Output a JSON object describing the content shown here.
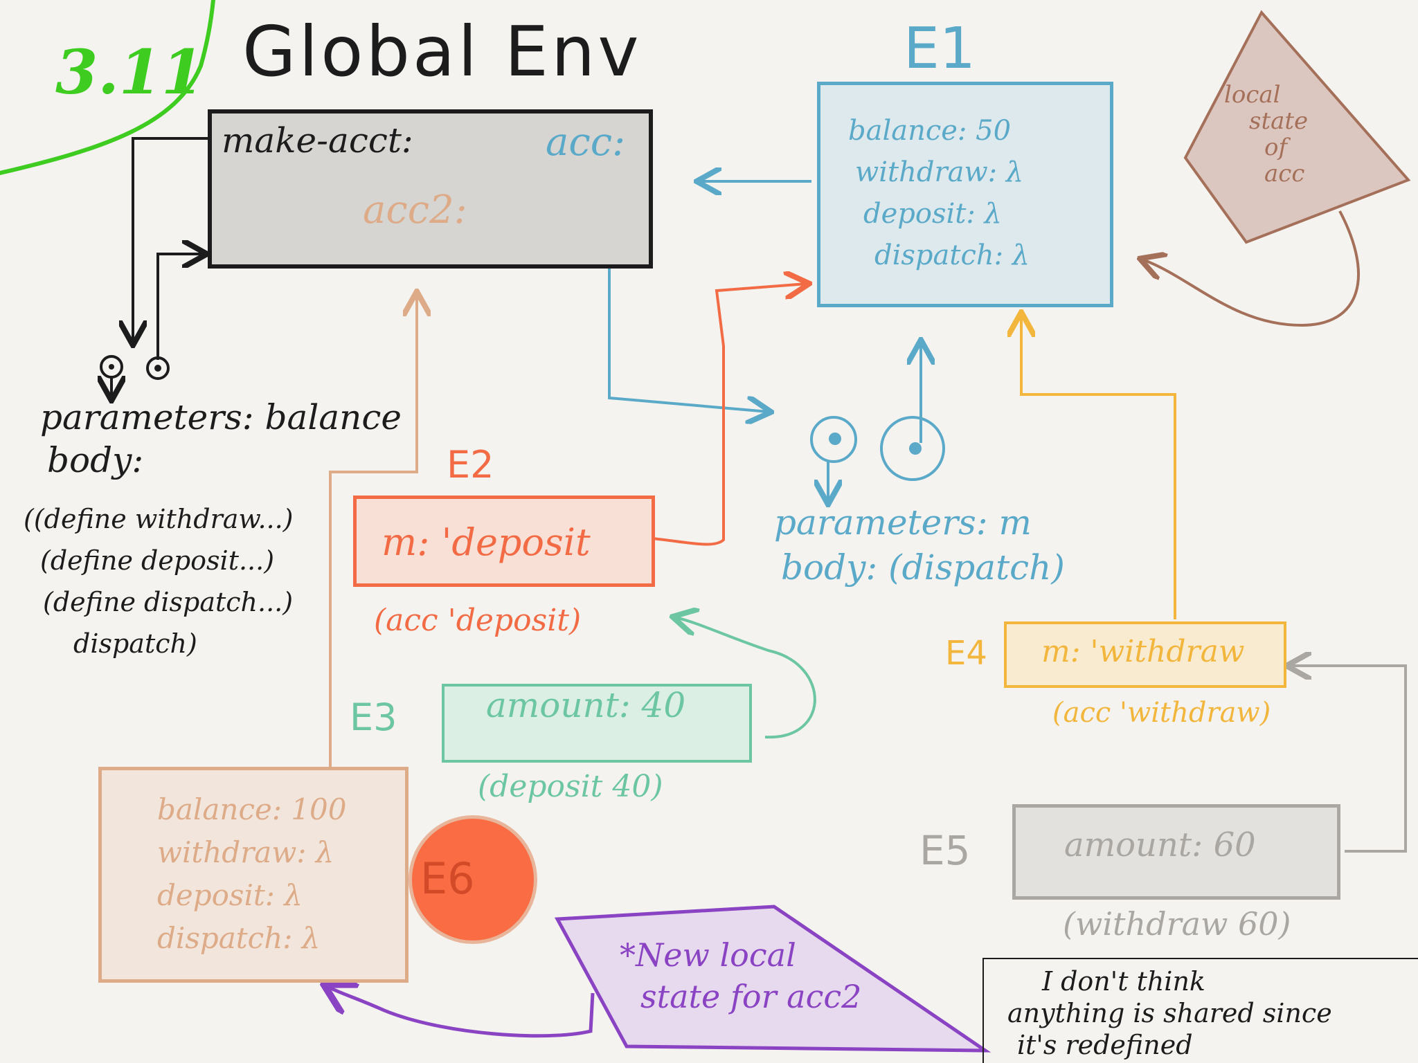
{
  "section": "3.11",
  "global_env": {
    "title": "Global Env",
    "make_acct": "make-acct:",
    "acc": "acc:",
    "acc2": "acc2:"
  },
  "procedure_make_acct": {
    "parameters": "parameters: balance",
    "body_label": "body:",
    "body_lines": [
      "((define withdraw...)",
      "(define deposit...)",
      "(define dispatch...)",
      "dispatch)"
    ]
  },
  "e1": {
    "label": "E1",
    "lines": [
      "balance: 50",
      "withdraw: λ",
      "deposit: λ",
      "dispatch: λ"
    ]
  },
  "local_state_note": [
    "local",
    "state",
    "of",
    "acc"
  ],
  "procedure_dispatch": {
    "parameters": "parameters: m",
    "body": "body: (dispatch)"
  },
  "e2": {
    "label": "E2",
    "binding": "m: 'deposit",
    "call": "(acc 'deposit)"
  },
  "e3": {
    "label": "E3",
    "binding": "amount: 40",
    "call": "(deposit 40)"
  },
  "e4": {
    "label": "E4",
    "binding": "m: 'withdraw",
    "call": "(acc 'withdraw)"
  },
  "e5": {
    "label": "E5",
    "binding": "amount: 60",
    "call": "(withdraw 60)"
  },
  "e6": {
    "label": "E6",
    "lines": [
      "balance: 100",
      "withdraw: λ",
      "deposit: λ",
      "dispatch: λ"
    ]
  },
  "new_state_note": [
    "*New local",
    "state for acc2"
  ],
  "comment": [
    "I don't think",
    "anything is shared since",
    "it's redefined"
  ],
  "colors": {
    "background": "#f4f3ef",
    "section_green": "#3dcc1f",
    "global": "#1c1c1c",
    "global_fill": "#d6d5d2",
    "e1": "#5aa9c8",
    "e1_fill": "#dde9ec",
    "e2": "#f26b45",
    "e3": "#6cc6a2",
    "e4": "#f2b63d",
    "e5": "#aaa7a2",
    "e6": "#ddab88",
    "e6_circle": "#f96c44",
    "acc_note": "#a5705a",
    "new_state": "#8a43c2"
  }
}
